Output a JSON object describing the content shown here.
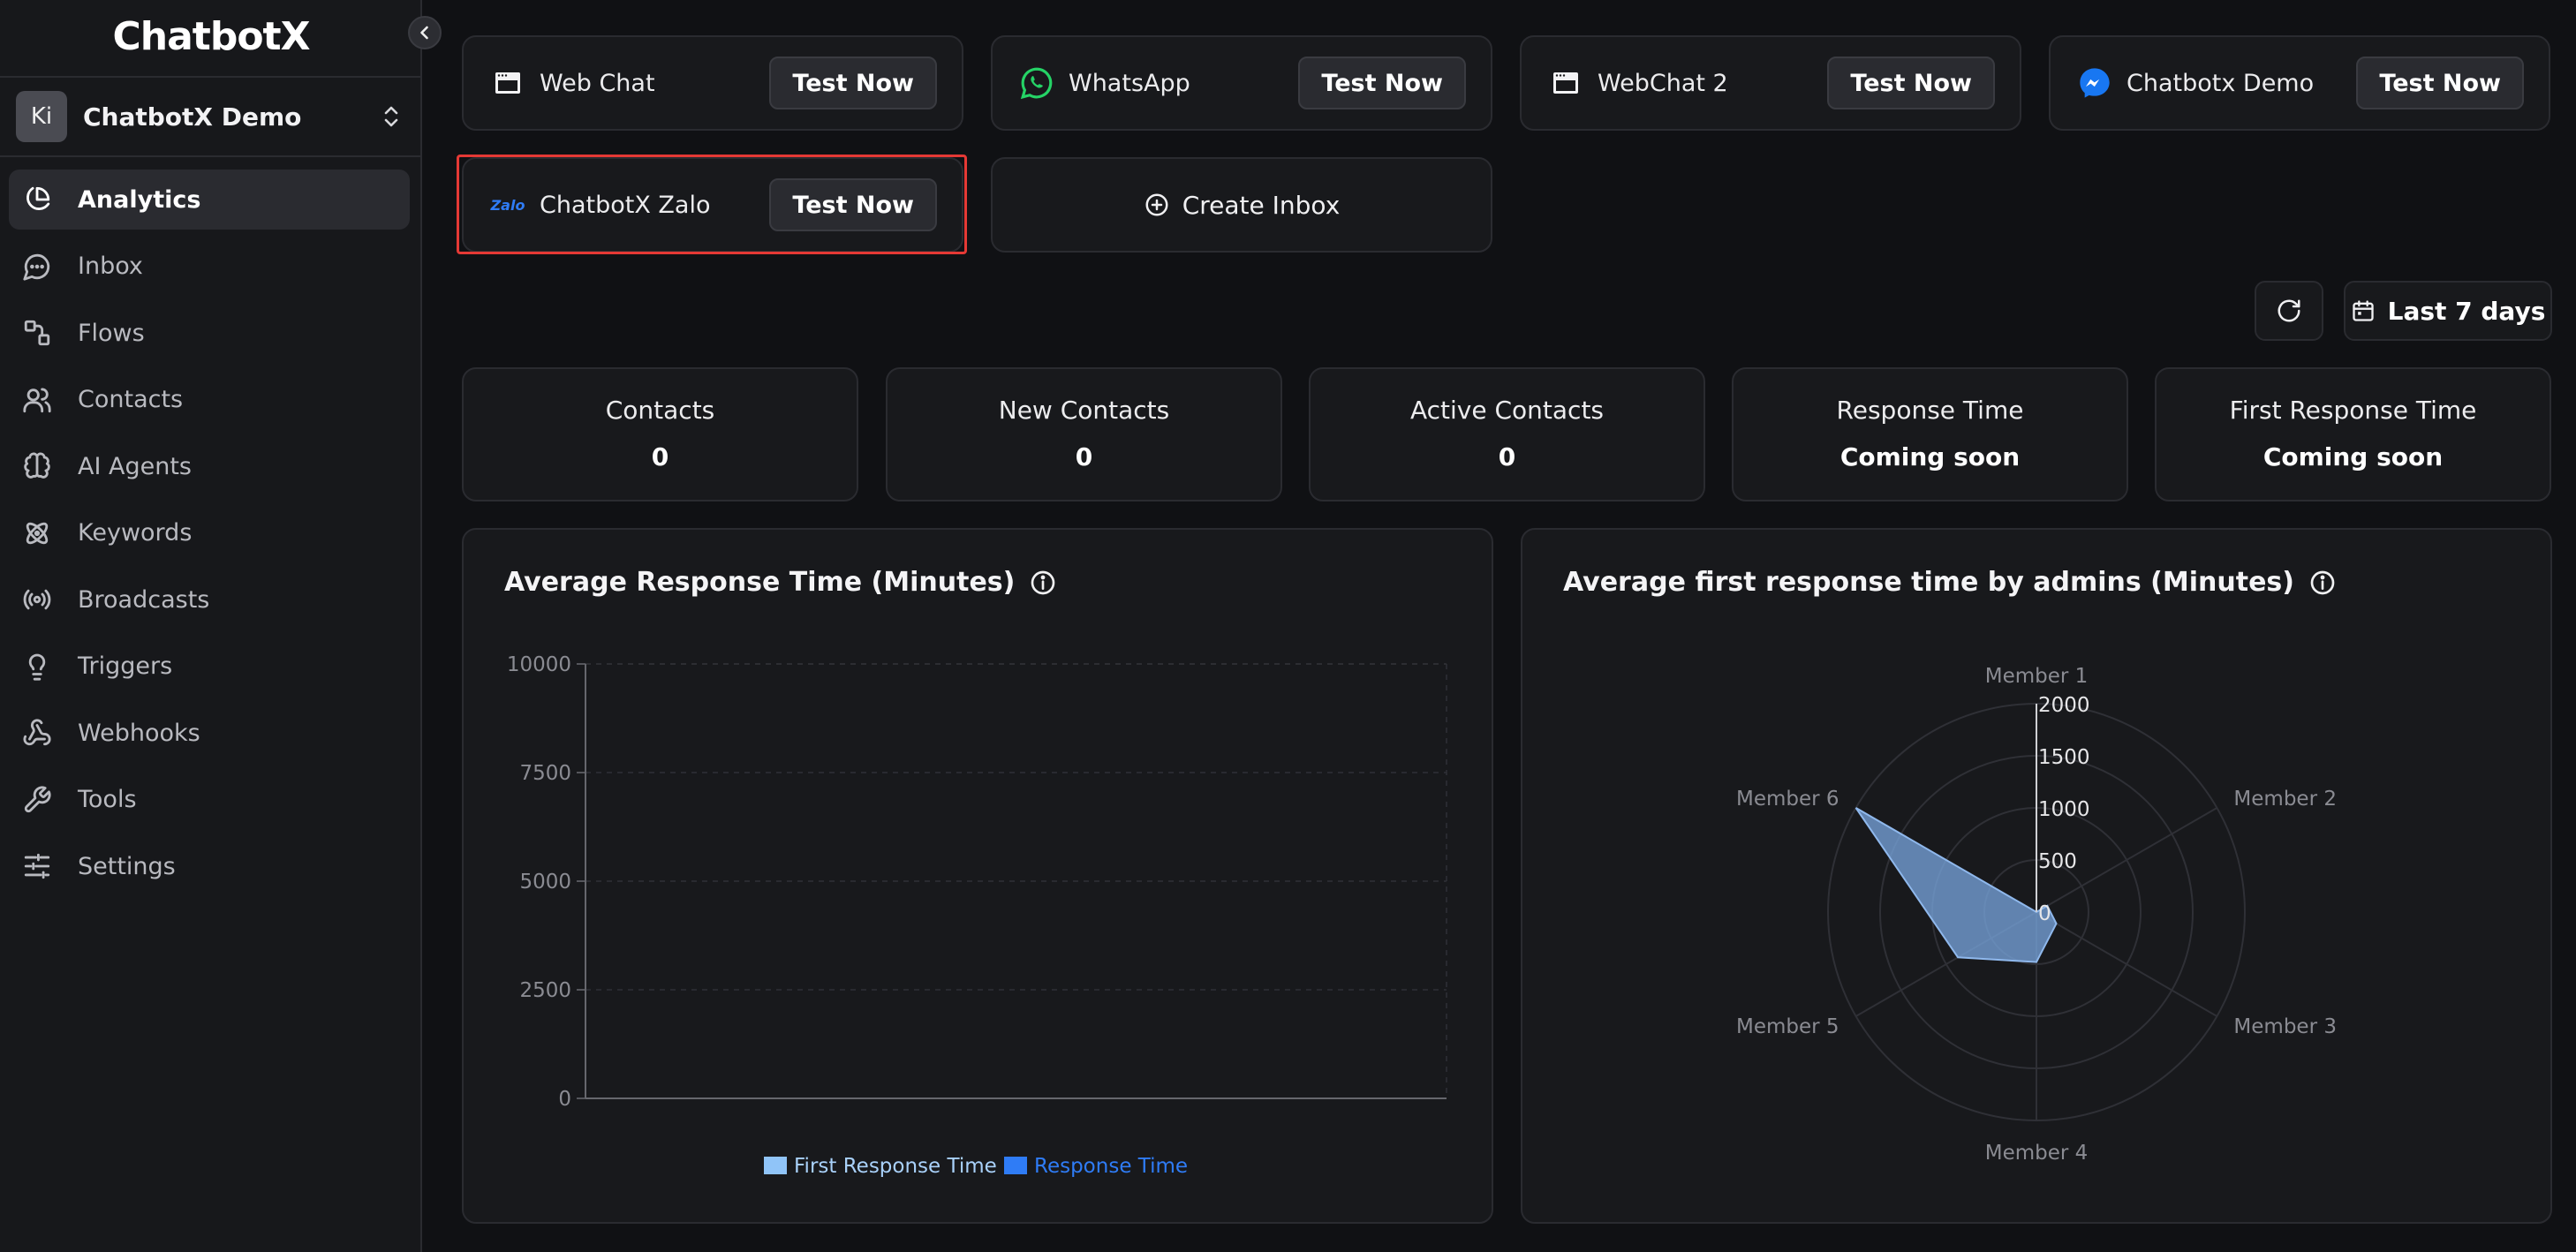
{
  "app": {
    "logo": "ChatbotX"
  },
  "workspace": {
    "initials": "Ki",
    "name": "ChatbotX Demo"
  },
  "sidebar": {
    "items": [
      {
        "label": "Analytics",
        "icon": "pie-chart-icon",
        "active": true
      },
      {
        "label": "Inbox",
        "icon": "chat-bubble-icon"
      },
      {
        "label": "Flows",
        "icon": "flows-icon"
      },
      {
        "label": "Contacts",
        "icon": "users-icon"
      },
      {
        "label": "AI Agents",
        "icon": "brain-icon"
      },
      {
        "label": "Keywords",
        "icon": "atom-icon"
      },
      {
        "label": "Broadcasts",
        "icon": "broadcast-icon"
      },
      {
        "label": "Triggers",
        "icon": "lightbulb-icon"
      },
      {
        "label": "Webhooks",
        "icon": "webhook-icon"
      },
      {
        "label": "Tools",
        "icon": "wrench-icon"
      },
      {
        "label": "Settings",
        "icon": "sliders-icon"
      }
    ]
  },
  "inboxes": [
    {
      "name": "Web Chat",
      "icon": "browser-window-icon",
      "button": "Test Now"
    },
    {
      "name": "WhatsApp",
      "icon": "whatsapp-icon",
      "button": "Test Now",
      "color": "#25d366"
    },
    {
      "name": "WebChat 2",
      "icon": "browser-window-icon",
      "button": "Test Now"
    },
    {
      "name": "Chatbotx Demo",
      "icon": "messenger-icon",
      "button": "Test Now",
      "color": "#1877f2"
    },
    {
      "name": "ChatbotX Zalo",
      "icon": "zalo-icon",
      "icon_text": "Zalo",
      "button": "Test Now",
      "color": "#2f7cf6"
    }
  ],
  "create_inbox": {
    "label": "Create Inbox"
  },
  "toolbar": {
    "range_label": "Last 7 days"
  },
  "stats": [
    {
      "label": "Contacts",
      "value": "0"
    },
    {
      "label": "New Contacts",
      "value": "0"
    },
    {
      "label": "Active Contacts",
      "value": "0"
    },
    {
      "label": "Response Time",
      "value": "Coming soon"
    },
    {
      "label": "First Response Time",
      "value": "Coming soon"
    }
  ],
  "colors": {
    "accent": "#2f7cf6",
    "first_response": "#90c4f8",
    "response": "#2f7cf6",
    "highlight": "#e53935",
    "radar_fill": "#7aa7e0"
  },
  "chart_data": [
    {
      "type": "bar",
      "title": "Average Response Time (Minutes)",
      "categories": [],
      "yticks": [
        0,
        2500,
        5000,
        7500,
        10000
      ],
      "ylim": [
        0,
        10000
      ],
      "grid": true,
      "legend_position": "bottom",
      "series": [
        {
          "name": "First Response Time",
          "values": []
        },
        {
          "name": "Response Time",
          "values": []
        }
      ]
    },
    {
      "type": "radar",
      "title": "Average first response time by admins (Minutes)",
      "axes": [
        "Member 1",
        "Member 2",
        "Member 3",
        "Member 4",
        "Member 5",
        "Member 6"
      ],
      "rticks": [
        0,
        500,
        1000,
        1500,
        2000
      ],
      "rlim": [
        0,
        2000
      ],
      "values": [
        0,
        120,
        220,
        480,
        870,
        2000
      ]
    }
  ]
}
